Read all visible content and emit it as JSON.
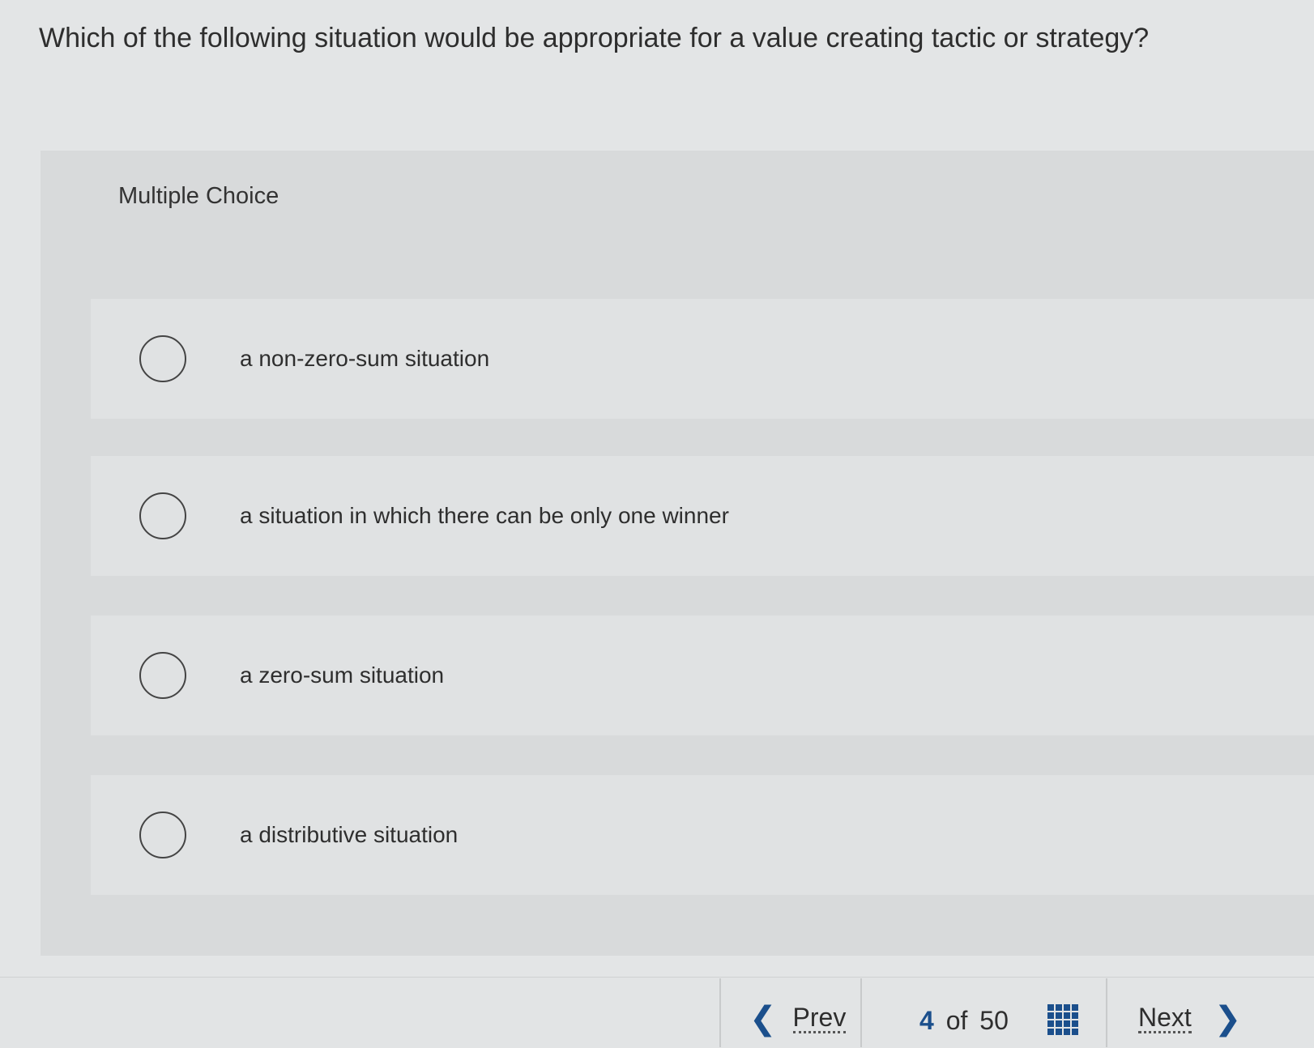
{
  "question": {
    "text": "Which of the following situation would be appropriate for a value creating tactic or strategy?"
  },
  "panel": {
    "type_label": "Multiple Choice"
  },
  "options": [
    {
      "label": "a non-zero-sum situation"
    },
    {
      "label": "a situation in which there can be only one winner"
    },
    {
      "label": "a zero-sum situation"
    },
    {
      "label": "a distributive situation"
    }
  ],
  "footer": {
    "prev_label": "Prev",
    "prev_icon": "chevron-left-icon",
    "current_page": "4",
    "of_text": "of",
    "total_pages": "50",
    "grid_icon": "grid-icon",
    "next_label": "Next",
    "next_icon": "chevron-right-icon",
    "accent_color": "#1b4f8c"
  }
}
